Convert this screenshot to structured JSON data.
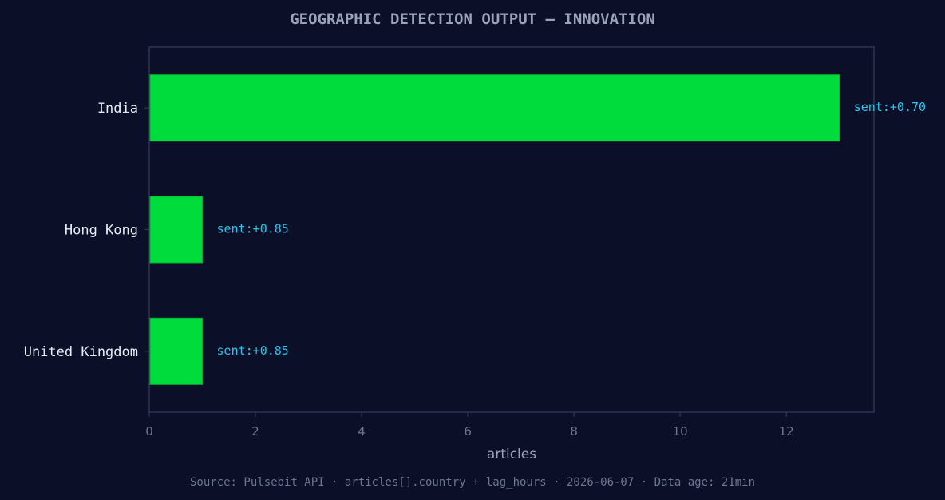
{
  "chart_data": {
    "type": "bar",
    "orientation": "horizontal",
    "title": "GEOGRAPHIC DETECTION OUTPUT — INNOVATION",
    "categories": [
      "India",
      "Hong Kong",
      "United Kingdom"
    ],
    "values": [
      13,
      1,
      1
    ],
    "annotations": [
      "sent:+0.70",
      "sent:+0.85",
      "sent:+0.85"
    ],
    "xlabel": "articles",
    "ylabel": "",
    "xlim": [
      0,
      13.65
    ],
    "xticks": [
      0,
      2,
      4,
      6,
      8,
      10,
      12
    ],
    "grid": false,
    "legend": "none",
    "source": "Source: Pulsebit API · articles[].country + lag_hours · 2026-06-07 · Data age: 21min"
  },
  "colors": {
    "background": "#0b0f28",
    "bar_fill": "#00dc3c",
    "annotation": "#22c8f0",
    "frame": "#2e3452"
  }
}
